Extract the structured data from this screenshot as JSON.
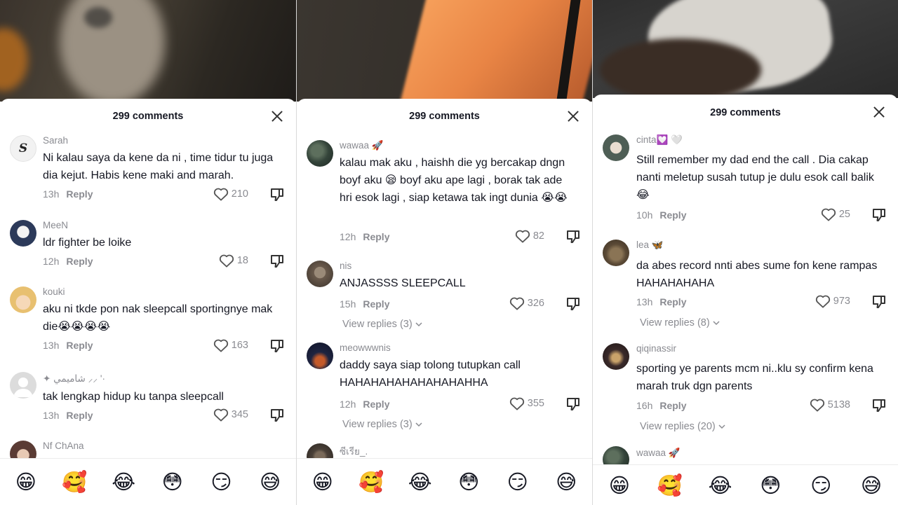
{
  "panels": [
    {
      "header": {
        "title": "299 comments"
      },
      "comments": [
        {
          "user": "Sarah",
          "text": "Ni kalau saya da kene da ni , time tidur tu juga dia kejut. Habis kene maki and marah.",
          "time": "13h",
          "reply_label": "Reply",
          "likes": "210",
          "avatar_color": "#f2f2f2"
        },
        {
          "user": "MeeN",
          "text": "ldr fighter be loike",
          "time": "12h",
          "reply_label": "Reply",
          "likes": "18",
          "avatar_color": "#2c3a5a"
        },
        {
          "user": "kouki",
          "text": "aku ni tkde pon nak sleepcall sportingnye mak die😭😭😭😭",
          "time": "13h",
          "reply_label": "Reply",
          "likes": "163",
          "avatar_color": "#e8c070"
        },
        {
          "user": "✦ شاميمي ⸝⸝ '·",
          "text": "tak lengkap hidup ku tanpa sleepcall",
          "time": "13h",
          "reply_label": "Reply",
          "likes": "345",
          "avatar_color": "#d6d6d6"
        },
        {
          "user": "Nf ChAna",
          "avatar_color": "#5a3b34"
        }
      ],
      "emojis": [
        "😁",
        "🥰",
        "😂",
        "😳",
        "😏",
        "😅"
      ]
    },
    {
      "header": {
        "title": "299 comments"
      },
      "comments": [
        {
          "user": "wawaa 🚀",
          "text": "kalau mak aku , haishh die yg bercakap dngn boyf aku 😪 boyf aku ape lagi , borak tak ade hri esok lagi , siap ketawa tak ingt dunia 😭😭",
          "time": "12h",
          "reply_label": "Reply",
          "likes": "82",
          "avatar_color": "#34443a"
        },
        {
          "user": "nis",
          "text": "ANJASSSS SLEEPCALL",
          "time": "15h",
          "reply_label": "Reply",
          "likes": "326",
          "view_replies": "View replies (3)",
          "avatar_color": "#6a5a4c"
        },
        {
          "user": "meowwwnis",
          "text": "daddy saya siap tolong tutupkan call HAHAHAHAHAHAHAHAHHA",
          "time": "12h",
          "reply_label": "Reply",
          "likes": "355",
          "view_replies": "View replies (3)",
          "avatar_color": "#1e2440"
        },
        {
          "user": "ซีเรีย_.",
          "avatar_color": "#4a4038"
        }
      ],
      "emojis": [
        "😁",
        "🥰",
        "😂",
        "😳",
        "😏",
        "😅"
      ]
    },
    {
      "header": {
        "title": "299 comments"
      },
      "comments": [
        {
          "user": "cinta💟 🤍",
          "text": "Still remember my dad end the call . Dia cakap nanti meletup susah tutup je dulu esok call balik😂",
          "time": "10h",
          "reply_label": "Reply",
          "likes": "25",
          "avatar_color": "#4e5e55"
        },
        {
          "user": "lea 🦋",
          "text": "da abes record nnti abes sume fon kene rampas HAHAHAHAHA",
          "time": "13h",
          "reply_label": "Reply",
          "likes": "973",
          "view_replies": "View replies (8)",
          "avatar_color": "#5b4a36"
        },
        {
          "user": "qiqinassir",
          "text": "sporting ye parents mcm ni..klu sy confirm kena marah truk dgn parents",
          "time": "16h",
          "reply_label": "Reply",
          "likes": "5138",
          "view_replies": "View replies (20)",
          "avatar_color": "#3a2a2a"
        },
        {
          "user": "wawaa 🚀",
          "avatar_color": "#34443a"
        }
      ],
      "emojis": [
        "😁",
        "🥰",
        "😂",
        "😳",
        "😏",
        "😅"
      ]
    }
  ],
  "colors": {
    "text_primary": "#161823",
    "text_secondary": "#8a8b91",
    "background": "#ffffff"
  }
}
